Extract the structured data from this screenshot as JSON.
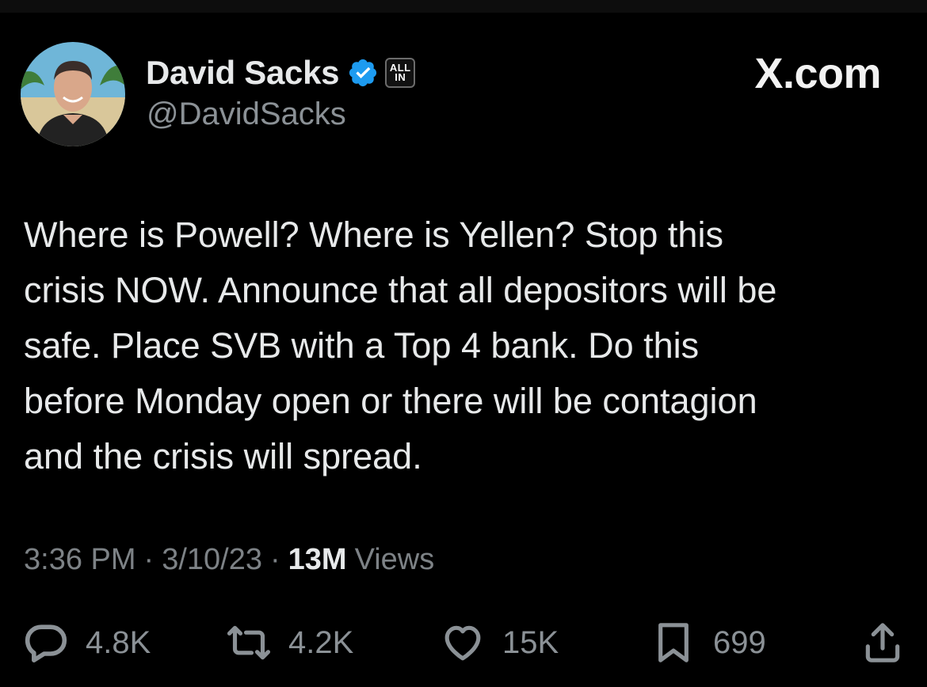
{
  "brand": "X.com",
  "author": {
    "display_name": "David Sacks",
    "handle": "@DavidSacks",
    "verified": true,
    "affiliate_badge": {
      "line1": "ALL",
      "line2": "IN"
    }
  },
  "tweet": {
    "text": "Where is Powell? Where is Yellen? Stop this\ncrisis NOW. Announce that all depositors will be\nsafe. Place SVB with a Top 4 bank. Do this\nbefore Monday open or there will be contagion\nand the crisis will spread.",
    "time": "3:36 PM",
    "date": "3/10/23",
    "sep": "·",
    "views_count": "13M",
    "views_label": "Views"
  },
  "actions": {
    "replies": "4.8K",
    "reposts": "4.2K",
    "likes": "15K",
    "bookmarks": "699"
  },
  "colors": {
    "background": "#000000",
    "text": "#e7e9ea",
    "secondary": "#8b9196",
    "verified": "#1d9bf0"
  },
  "icons": [
    "verified-badge-icon",
    "reply-icon",
    "repost-icon",
    "like-icon",
    "bookmark-icon",
    "share-icon"
  ]
}
